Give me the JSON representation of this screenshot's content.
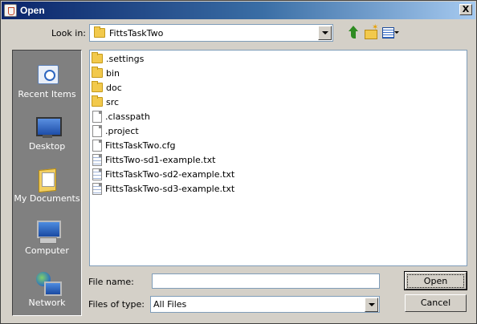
{
  "window": {
    "title": "Open",
    "close_label": "X"
  },
  "toolbar": {
    "look_in_label": "Look in:",
    "look_in_value": "FittsTaskTwo",
    "icons": [
      "up-one-level-icon",
      "new-folder-icon",
      "view-menu-icon"
    ]
  },
  "places": [
    {
      "label": "Recent Items",
      "icon": "recent-items-icon"
    },
    {
      "label": "Desktop",
      "icon": "desktop-icon"
    },
    {
      "label": "My Documents",
      "icon": "my-documents-icon"
    },
    {
      "label": "Computer",
      "icon": "computer-icon"
    },
    {
      "label": "Network",
      "icon": "network-icon"
    }
  ],
  "files": [
    {
      "name": ".settings",
      "type": "folder"
    },
    {
      "name": "bin",
      "type": "folder"
    },
    {
      "name": "doc",
      "type": "folder"
    },
    {
      "name": "src",
      "type": "folder"
    },
    {
      "name": ".classpath",
      "type": "file"
    },
    {
      "name": ".project",
      "type": "file"
    },
    {
      "name": "FittsTaskTwo.cfg",
      "type": "file"
    },
    {
      "name": "FittsTwo-sd1-example.txt",
      "type": "text"
    },
    {
      "name": "FittsTaskTwo-sd2-example.txt",
      "type": "text"
    },
    {
      "name": "FittsTaskTwo-sd3-example.txt",
      "type": "text"
    }
  ],
  "form": {
    "file_name_label": "File name:",
    "file_name_value": "",
    "files_of_type_label": "Files of type:",
    "files_of_type_value": "All Files"
  },
  "buttons": {
    "open": "Open",
    "cancel": "Cancel"
  }
}
